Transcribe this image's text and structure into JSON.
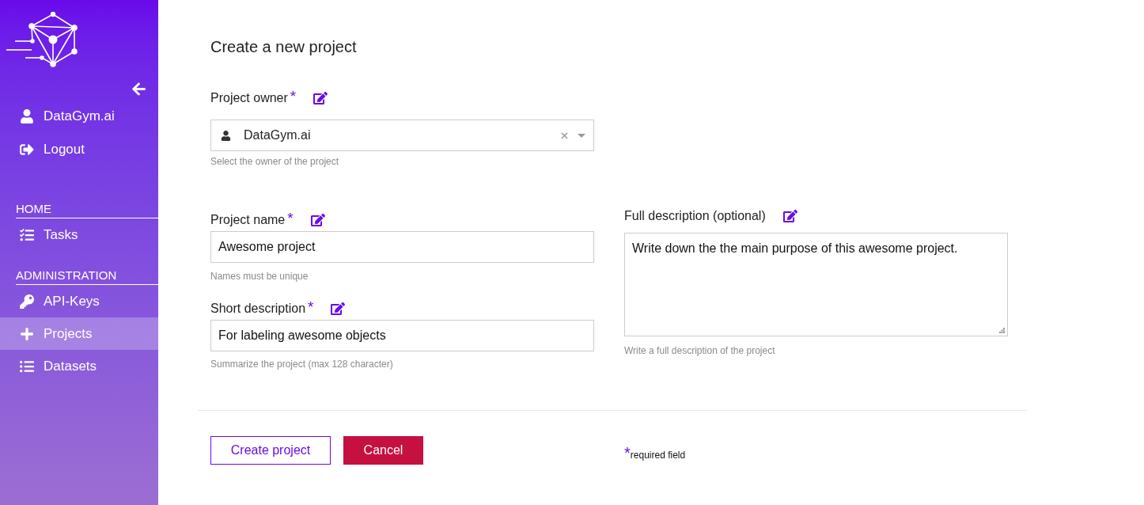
{
  "sidebar": {
    "account": [
      {
        "label": "DataGym.ai"
      },
      {
        "label": "Logout"
      }
    ],
    "sections": [
      {
        "heading": "HOME",
        "items": [
          {
            "label": "Tasks",
            "selected": false
          }
        ]
      },
      {
        "heading": "ADMINISTRATION",
        "items": [
          {
            "label": "API-Keys",
            "selected": false
          },
          {
            "label": "Projects",
            "selected": true
          },
          {
            "label": "Datasets",
            "selected": false
          }
        ]
      }
    ]
  },
  "form": {
    "title": "Create a new project",
    "owner": {
      "label": "Project owner",
      "required_mark": "*",
      "value": "DataGym.ai",
      "hint": "Select the owner of the project"
    },
    "left_fields": [
      {
        "label": "Project name",
        "required_mark": "*",
        "value": "Awesome project",
        "hint": "Names must be unique"
      },
      {
        "label": "Short description",
        "required_mark": "*",
        "value": "For labeling awesome objects",
        "hint": "Summarize the project (max 128 character)"
      }
    ],
    "right_fields": [
      {
        "label": "Full description (optional)",
        "value": "Write down the the main purpose of this awesome project.",
        "hint": "Write a full description of the project"
      }
    ],
    "buttons": [
      {
        "label": "Create project",
        "kind": "outline"
      },
      {
        "label": "Cancel",
        "kind": "danger"
      }
    ],
    "required_note": {
      "mark": "*",
      "text": "required field"
    }
  }
}
